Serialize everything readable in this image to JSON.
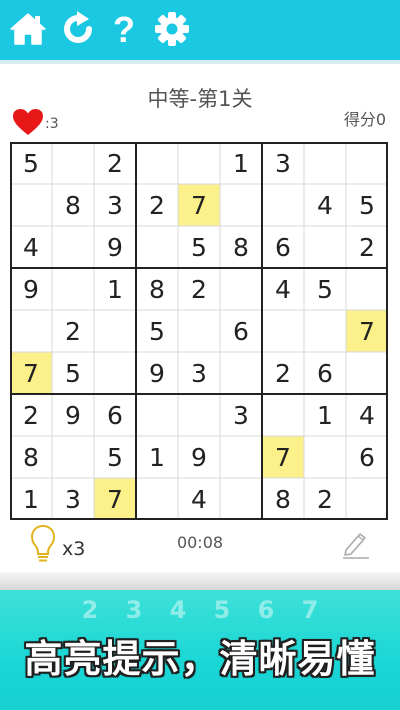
{
  "toolbar": {
    "icons": [
      "home-icon",
      "restart-icon",
      "help-icon",
      "settings-icon"
    ],
    "color": "#1bc8e2"
  },
  "level": {
    "title": "中等-第1关"
  },
  "lives": {
    "count": ":3",
    "icon": "heart-icon",
    "color": "#e81818"
  },
  "score": {
    "label": "得分0"
  },
  "board": {
    "rows": [
      [
        "5",
        "",
        "2",
        "",
        "",
        "1",
        "3",
        "",
        ""
      ],
      [
        "",
        "8",
        "3",
        "2",
        "7",
        "",
        "",
        "4",
        "5"
      ],
      [
        "4",
        "",
        "9",
        "",
        "5",
        "8",
        "6",
        "",
        "2"
      ],
      [
        "9",
        "",
        "1",
        "8",
        "2",
        "",
        "4",
        "5",
        ""
      ],
      [
        "",
        "2",
        "",
        "5",
        "",
        "6",
        "",
        "",
        "7"
      ],
      [
        "7",
        "5",
        "",
        "9",
        "3",
        "",
        "2",
        "6",
        ""
      ],
      [
        "2",
        "9",
        "6",
        "",
        "",
        "3",
        "",
        "1",
        "4"
      ],
      [
        "8",
        "",
        "5",
        "1",
        "9",
        "",
        "7",
        "",
        "6"
      ],
      [
        "1",
        "3",
        "7",
        "",
        "4",
        "",
        "8",
        "2",
        ""
      ]
    ],
    "highlighted": [
      [
        1,
        4
      ],
      [
        4,
        8
      ],
      [
        5,
        0
      ],
      [
        7,
        6
      ],
      [
        8,
        2
      ]
    ],
    "highlight_color": "#fbf08a"
  },
  "hints": {
    "count": "x3",
    "icon": "lightbulb-icon"
  },
  "timer": {
    "value": "00:08"
  },
  "pencil": {
    "icon": "pencil-icon"
  },
  "banner": {
    "text": "高亮提示，清晰易懂",
    "ghost_digits": [
      "2",
      "3",
      "4",
      "5",
      "6",
      "7"
    ]
  }
}
